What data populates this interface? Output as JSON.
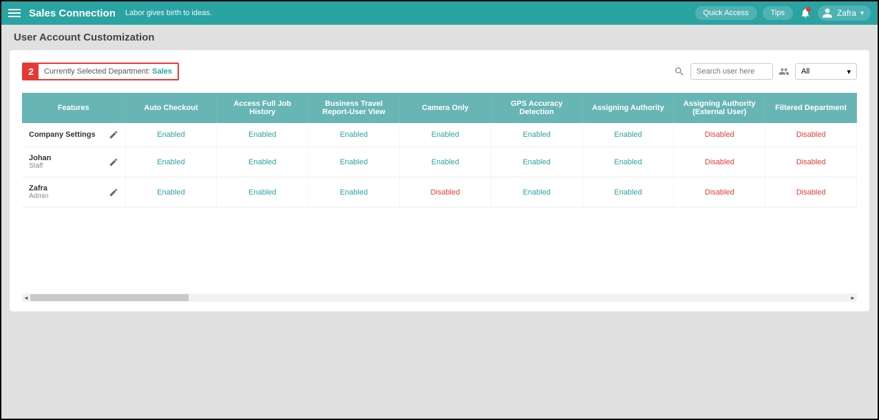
{
  "colors": {
    "teal": "#2aa3a3",
    "headerTeal": "#68b5b5",
    "red": "#e53935"
  },
  "header": {
    "brand": "Sales Connection",
    "tagline": "Labor gives birth to ideas.",
    "quick_access": "Quick Access",
    "tips": "Tips",
    "username": "Zafra"
  },
  "page": {
    "title": "User Account Customization"
  },
  "callout": {
    "number": "2",
    "label": "Currently Selected Department: ",
    "value": "Sales"
  },
  "search": {
    "placeholder": "Search user here"
  },
  "filter": {
    "selected": "All"
  },
  "table": {
    "columns": [
      "Features",
      "Auto Checkout",
      "Access Full Job History",
      "Business Travel Report-User View",
      "Camera Only",
      "GPS Accuracy Detection",
      "Assigning Authority",
      "Assigning Authority (External User)",
      "Filtered Department"
    ],
    "rows": [
      {
        "name": "Company Settings",
        "role": "",
        "values": [
          "Enabled",
          "Enabled",
          "Enabled",
          "Enabled",
          "Enabled",
          "Enabled",
          "Disabled",
          "Disabled"
        ]
      },
      {
        "name": "Johan",
        "role": "Staff",
        "values": [
          "Enabled",
          "Enabled",
          "Enabled",
          "Enabled",
          "Enabled",
          "Enabled",
          "Disabled",
          "Disabled"
        ]
      },
      {
        "name": "Zafra",
        "role": "Admin",
        "values": [
          "Enabled",
          "Enabled",
          "Enabled",
          "Disabled",
          "Enabled",
          "Enabled",
          "Disabled",
          "Disabled"
        ]
      }
    ]
  }
}
